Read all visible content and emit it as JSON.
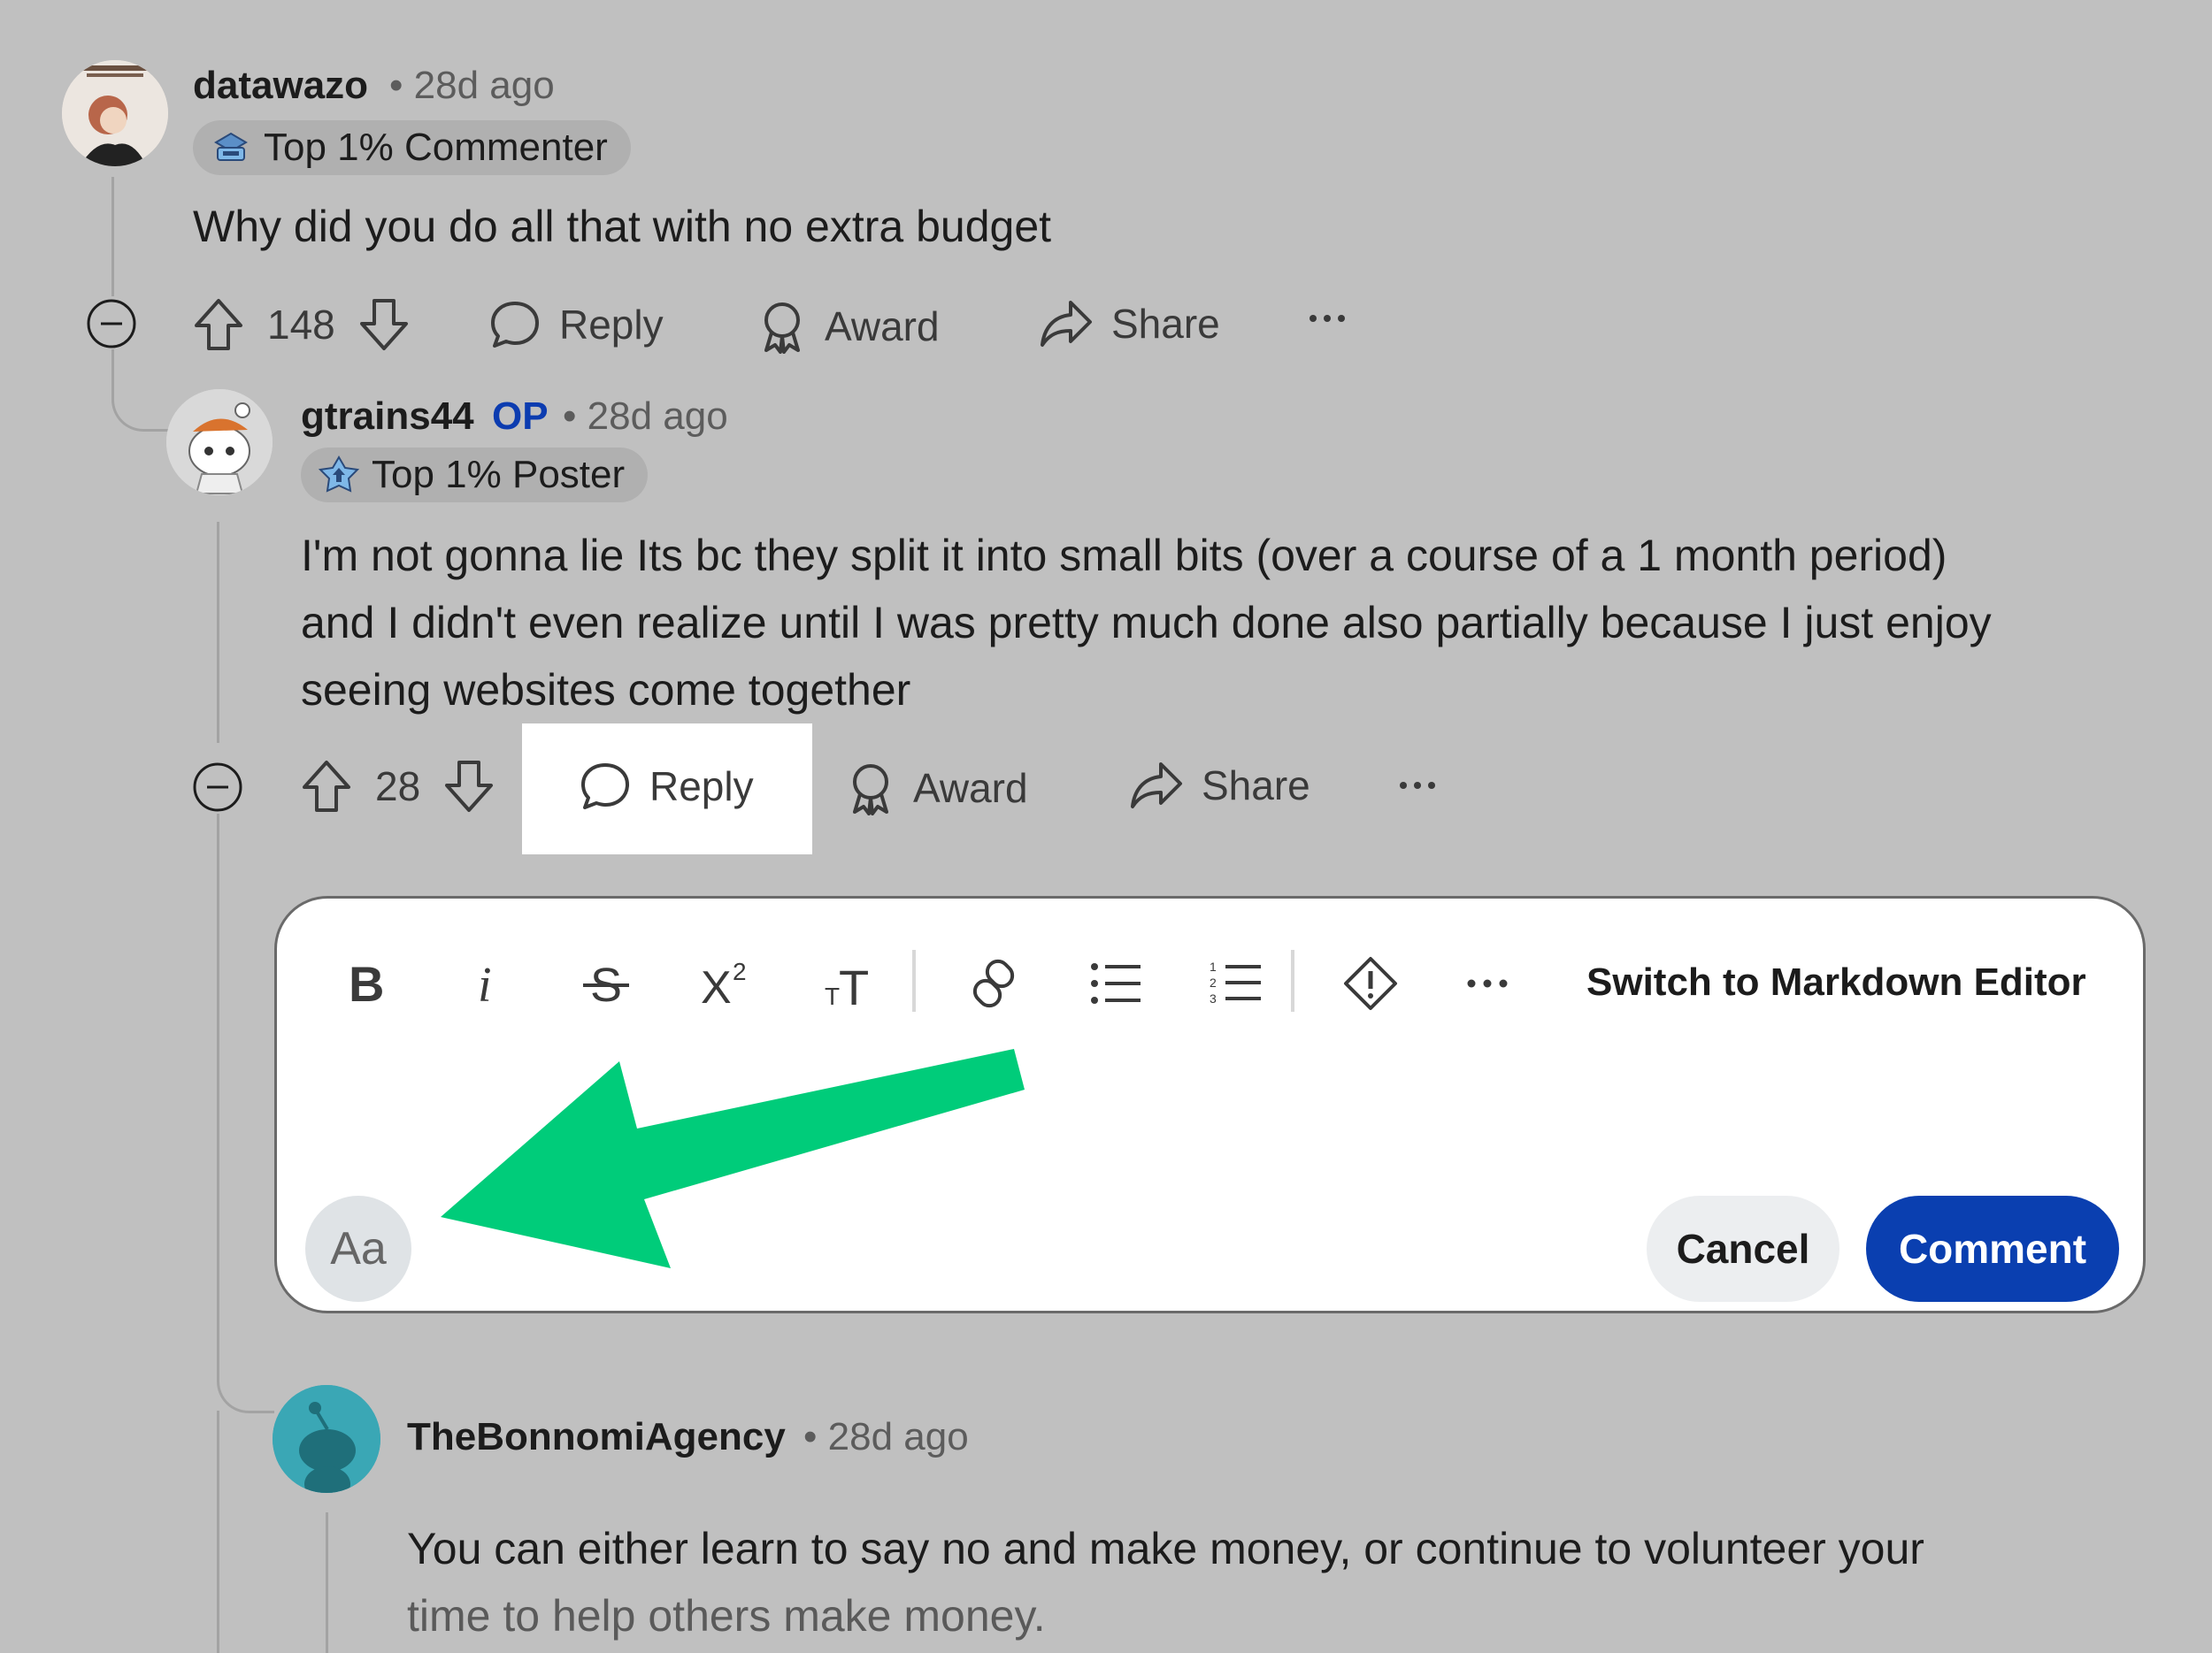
{
  "comments": [
    {
      "username": "datawazo",
      "op_label": "",
      "age": "28d ago",
      "badge": "Top 1% Commenter",
      "body": "Why did you do all that with no extra budget",
      "votes": "148",
      "actions": {
        "reply": "Reply",
        "award": "Award",
        "share": "Share"
      }
    },
    {
      "username": "gtrains44",
      "op_label": "OP",
      "age": "28d ago",
      "badge": "Top 1% Poster",
      "body_lines": [
        "I'm not gonna lie Its bc they split it into small bits (over a course of a 1 month period)",
        "and I didn't even realize until I was pretty much done also partially because I just enjoy",
        "seeing websites come together"
      ],
      "votes": "28",
      "actions": {
        "reply": "Reply",
        "award": "Award",
        "share": "Share"
      }
    },
    {
      "username": "TheBonnomiAgency",
      "age": "28d ago",
      "body_lines": [
        "You can either learn to say no and make money, or continue to volunteer your",
        "time to help others make money."
      ]
    }
  ],
  "editor": {
    "toolbar": [
      "bold",
      "italic",
      "strikethrough",
      "superscript",
      "heading",
      "link",
      "bulleted-list",
      "numbered-list",
      "spoiler",
      "more"
    ],
    "switch_label": "Switch to Markdown Editor",
    "format_button": "Aa",
    "cancel": "Cancel",
    "submit": "Comment"
  },
  "colors": {
    "background": "#c0c0c0",
    "accent_blue": "#0a3fb0",
    "arrow_green": "#00cc7a",
    "op_blue": "#0c3cb0"
  },
  "icons": [
    "upvote-icon",
    "downvote-icon",
    "reply-bubble-icon",
    "award-icon",
    "share-icon",
    "ellipsis-icon",
    "collapse-icon",
    "spoiler-icon",
    "link-icon"
  ]
}
